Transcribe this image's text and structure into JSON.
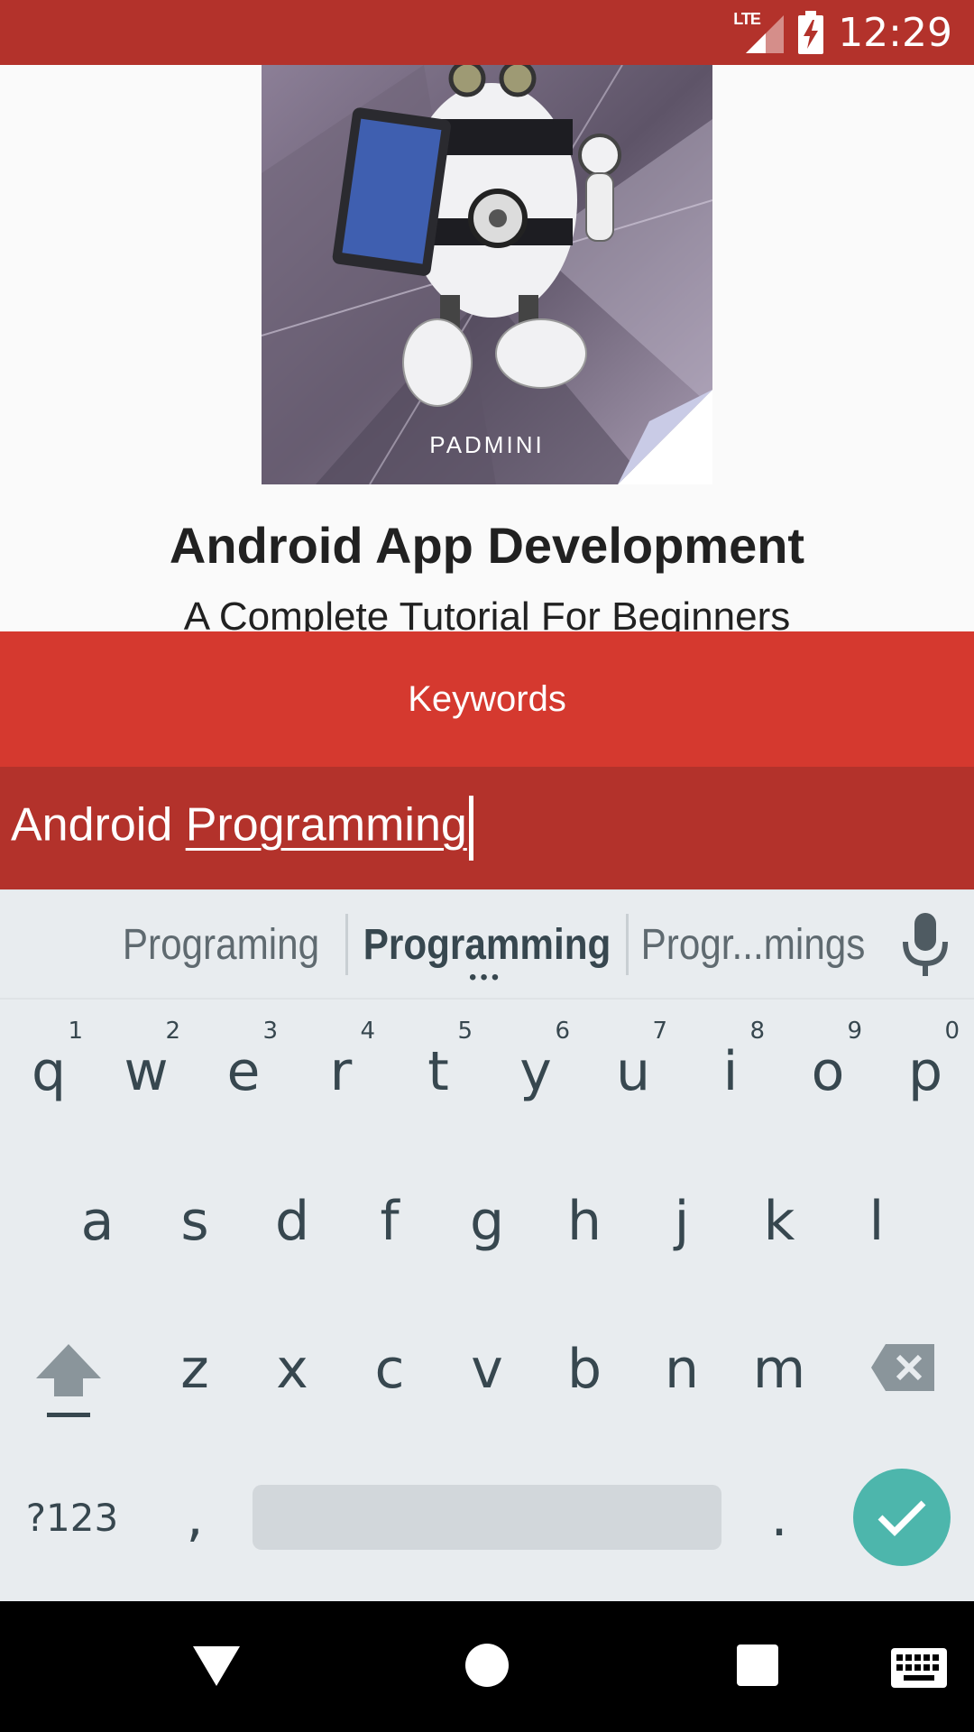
{
  "status_bar": {
    "time": "12:29",
    "network_label": "LTE",
    "icons": [
      "signal-icon",
      "battery-charging-icon"
    ]
  },
  "book": {
    "cover_author": "PADMINI",
    "cover_tablet_text": "A Complete Tutorial For Beginners",
    "title": "Android App Development",
    "subtitle": "A Complete Tutorial For Beginners"
  },
  "dialog": {
    "header": "Keywords",
    "input_prefix": "Android ",
    "input_composing": "Programming"
  },
  "suggestions": {
    "left": "Programing",
    "middle": "Programming",
    "right": "Progr...mings",
    "more_indicator": "•••"
  },
  "keyboard": {
    "row1": [
      {
        "key": "q",
        "hint": "1"
      },
      {
        "key": "w",
        "hint": "2"
      },
      {
        "key": "e",
        "hint": "3"
      },
      {
        "key": "r",
        "hint": "4"
      },
      {
        "key": "t",
        "hint": "5"
      },
      {
        "key": "y",
        "hint": "6"
      },
      {
        "key": "u",
        "hint": "7"
      },
      {
        "key": "i",
        "hint": "8"
      },
      {
        "key": "o",
        "hint": "9"
      },
      {
        "key": "p",
        "hint": "0"
      }
    ],
    "row2": [
      "a",
      "s",
      "d",
      "f",
      "g",
      "h",
      "j",
      "k",
      "l"
    ],
    "row3": [
      "z",
      "x",
      "c",
      "v",
      "b",
      "n",
      "m"
    ],
    "symbols_label": "?123",
    "comma": ",",
    "period": "."
  },
  "colors": {
    "primary_dark": "#b3322b",
    "primary": "#d5392f",
    "accent_done": "#4db6ac",
    "keyboard_bg": "#e8ecef"
  }
}
